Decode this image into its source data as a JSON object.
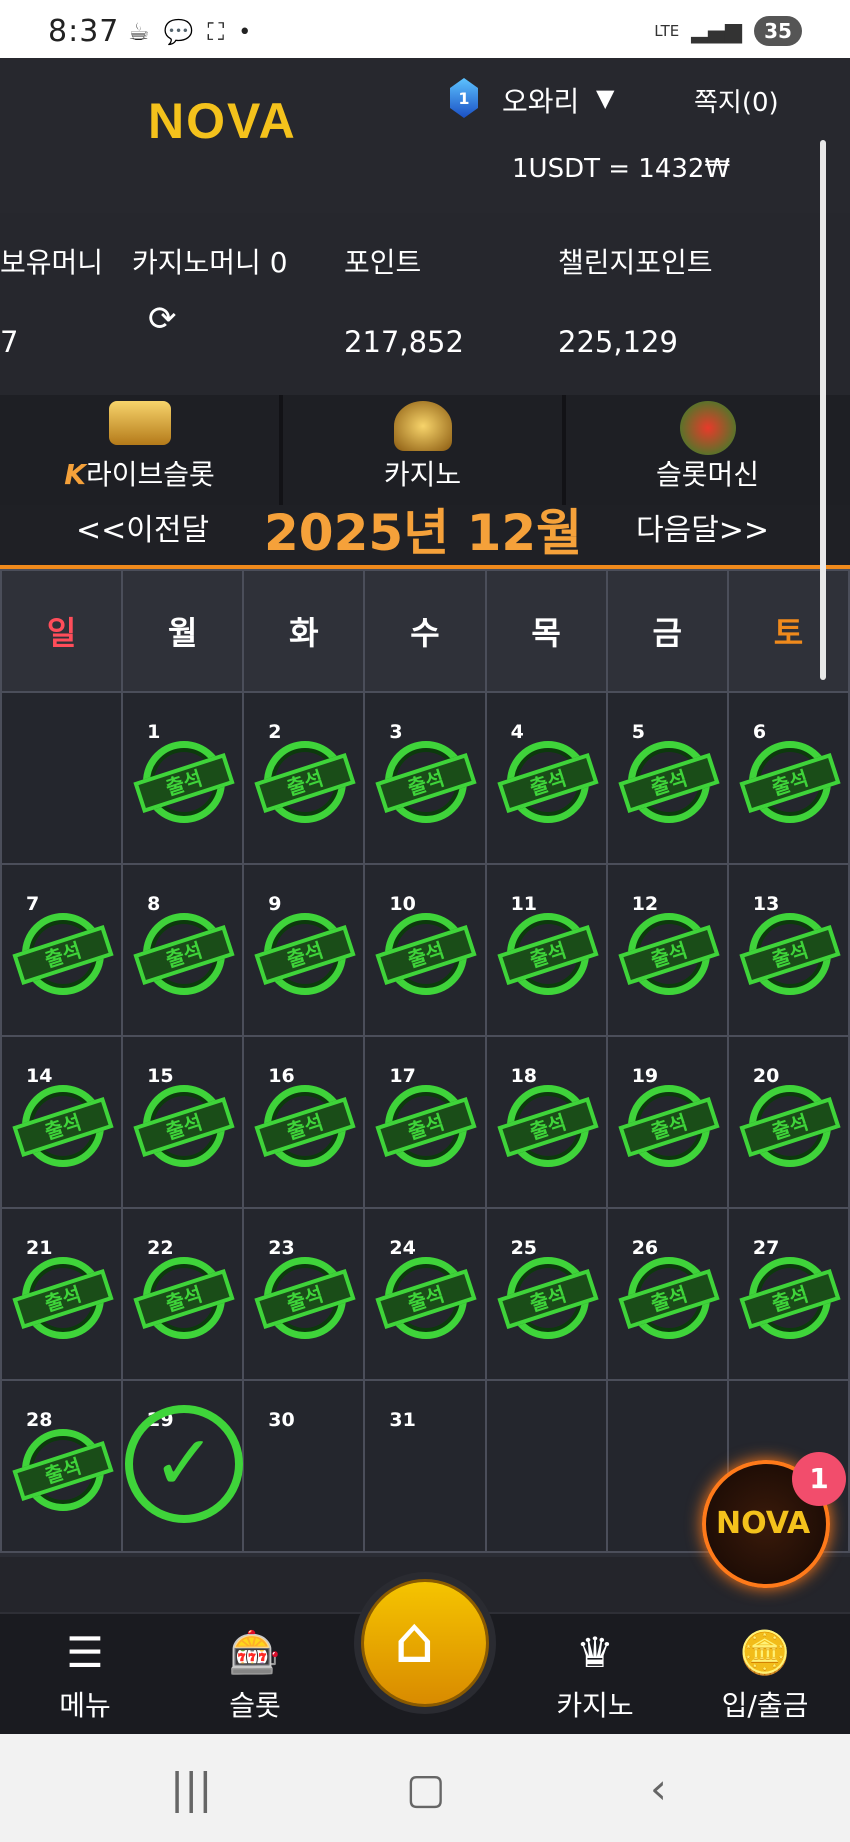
{
  "status": {
    "time": "8:37",
    "network": "LTE",
    "battery": "35"
  },
  "header": {
    "logo": "NOVA",
    "grade": "1",
    "username": "오와리",
    "messages": "쪽지(0)",
    "rate": "1USDT = 1432₩"
  },
  "money": {
    "holding_label": "보유머니",
    "holding_value": "7",
    "casino_label": "카지노머니 0",
    "point_label": "포인트",
    "point_value": "217,852",
    "challenge_label": "챌린지포인트",
    "challenge_value": "225,129"
  },
  "tabs": [
    {
      "label": "라이브슬롯",
      "icon": "live-slot-icon"
    },
    {
      "label": "카지노",
      "icon": "k-slot-icon"
    },
    {
      "label": "슬롯머신",
      "icon": "777-slots-icon"
    }
  ],
  "calendar": {
    "prev": "<<이전달",
    "month": "2025년 12월",
    "next": "다음달>>",
    "weekdays": [
      "일",
      "월",
      "화",
      "수",
      "목",
      "금",
      "토"
    ],
    "stamp_label": "출석",
    "days": [
      "1",
      "2",
      "3",
      "4",
      "5",
      "6",
      "7",
      "8",
      "9",
      "10",
      "11",
      "12",
      "13",
      "14",
      "15",
      "16",
      "17",
      "18",
      "19",
      "20",
      "21",
      "22",
      "23",
      "24",
      "25",
      "26",
      "27",
      "28",
      "29",
      "30",
      "31"
    ]
  },
  "fab": {
    "logo": "NOVA",
    "badge": "1"
  },
  "bottom_nav": [
    {
      "label": "메뉴",
      "icon": "hamburger-icon"
    },
    {
      "label": "슬롯",
      "icon": "slot-machine-icon"
    },
    {
      "label": "",
      "icon": "home-icon"
    },
    {
      "label": "카지노",
      "icon": "k-slot-icon"
    },
    {
      "label": "입/출금",
      "icon": "coins-icon"
    }
  ],
  "colors": {
    "accent": "#f08a1c",
    "stamp": "#3fd43a",
    "sunday": "#ff4d5a",
    "saturday": "#f08a1c"
  }
}
